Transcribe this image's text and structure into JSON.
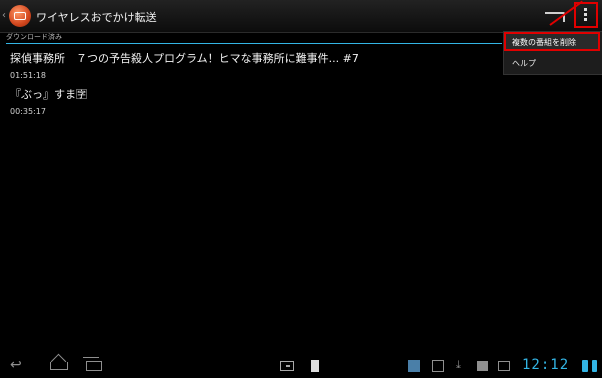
{
  "actionbar": {
    "title": "ワイヤレスおでかけ転送",
    "icons": [
      "back-caret-icon",
      "app-icon",
      "cast-icon",
      "overflow-menu-icon"
    ]
  },
  "section": {
    "header": "ダウンロード済み"
  },
  "items": [
    {
      "title": "探偵事務所　７つの予告殺人プログラム！ヒマな事務所に難事件... #7",
      "duration": "01:51:18"
    },
    {
      "title": "『ぶっ』すま🈑",
      "duration": "00:35:17"
    }
  ],
  "menu": {
    "items": [
      "複数の番組を削除",
      "ヘルプ"
    ]
  },
  "systembar": {
    "time": "12:12",
    "accent": "#33b5e5",
    "highlight": "#e00000"
  }
}
